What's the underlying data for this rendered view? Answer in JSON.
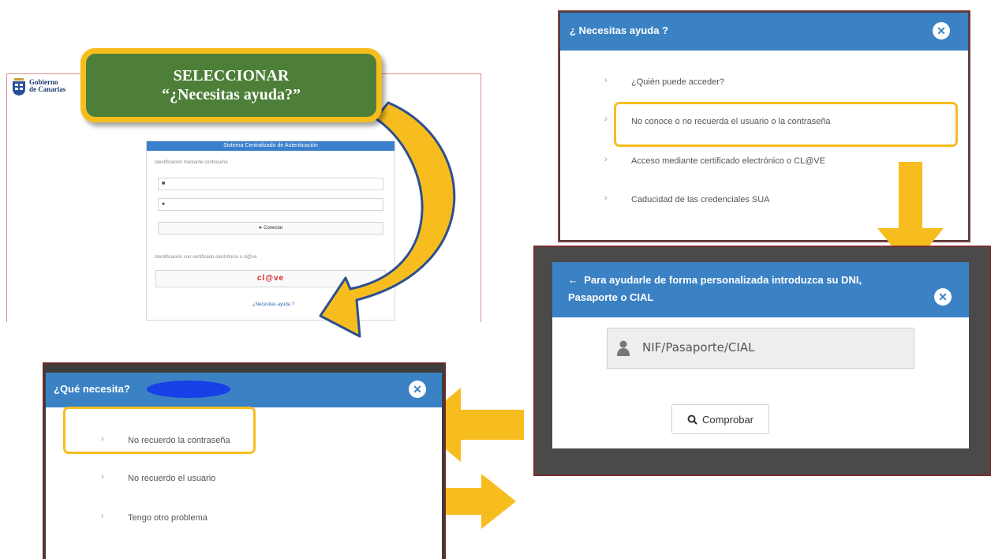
{
  "login": {
    "logo_line1": "Gobierno",
    "logo_line2": "de Canarias",
    "title": "Sistema Centralizado de Autenticación",
    "password_section": "Identificación mediante contraseña",
    "connect_label": "Conectar",
    "cert_section": "Identificación con certificado electrónico o cl@ve",
    "clave_label": "cl@ve",
    "help_link": "¿Necesitas ayuda ?"
  },
  "callout": {
    "line1": "SELECCIONAR",
    "line2": "“¿Necesitas ayuda?”"
  },
  "help_dialog": {
    "title": "¿ Necesitas ayuda ?",
    "items": [
      "¿Quién puede acceder?",
      "No conoce o no recuerda el usuario o la contraseña",
      "Acceso mediante certificado electrónico o CL@VE",
      "Caducidad de las credenciales SUA"
    ]
  },
  "dni_dialog": {
    "title_line1": "Para ayudarle de forma personalizada introduzca su DNI,",
    "title_line2": "Pasaporte o CIAL",
    "input_placeholder": "NIF/Pasaporte/CIAL",
    "check_button": "Comprobar"
  },
  "need_dialog": {
    "title": "¿Qué necesita?",
    "items": [
      "No recuerdo la contraseña",
      "No recuerdo el usuario",
      "Tengo otro problema"
    ]
  },
  "colors": {
    "accent_blue": "#3b82c4",
    "highlight_yellow": "#f7bd1f",
    "callout_green": "#4d7f38"
  }
}
